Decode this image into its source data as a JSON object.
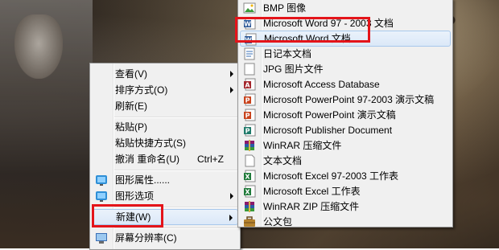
{
  "main_menu": {
    "items": [
      {
        "label": "查看(V)",
        "submenu": true
      },
      {
        "label": "排序方式(O)",
        "submenu": true
      },
      {
        "label": "刷新(E)"
      },
      {
        "label": "粘贴(P)"
      },
      {
        "label": "粘贴快捷方式(S)"
      },
      {
        "label": "撤消 重命名(U)",
        "shortcut": "Ctrl+Z"
      },
      {
        "label": "图形属性......",
        "icon": "graphics-properties-icon"
      },
      {
        "label": "图形选项",
        "icon": "graphics-options-icon",
        "submenu": true
      },
      {
        "label": "新建(W)",
        "submenu": true,
        "highlighted": true
      },
      {
        "label": "屏幕分辨率(C)",
        "icon": "screen-resolution-icon"
      }
    ]
  },
  "new_submenu": {
    "items": [
      {
        "label": "BMP 图像",
        "icon": "bmp-image-icon"
      },
      {
        "label": "Microsoft Word 97 - 2003 文档",
        "icon": "word-icon"
      },
      {
        "label": "Microsoft Word 文档",
        "icon": "word-icon",
        "highlighted": true
      },
      {
        "label": "日记本文档",
        "icon": "journal-icon"
      },
      {
        "label": "JPG 图片文件",
        "icon": "jpg-image-icon"
      },
      {
        "label": "Microsoft Access Database",
        "icon": "access-icon"
      },
      {
        "label": "Microsoft PowerPoint 97-2003 演示文稿",
        "icon": "powerpoint-icon"
      },
      {
        "label": "Microsoft PowerPoint 演示文稿",
        "icon": "powerpoint-icon"
      },
      {
        "label": "Microsoft Publisher Document",
        "icon": "publisher-icon"
      },
      {
        "label": "WinRAR 压缩文件",
        "icon": "winrar-icon"
      },
      {
        "label": "文本文档",
        "icon": "text-document-icon"
      },
      {
        "label": "Microsoft Excel 97-2003 工作表",
        "icon": "excel-icon"
      },
      {
        "label": "Microsoft Excel 工作表",
        "icon": "excel-icon"
      },
      {
        "label": "WinRAR ZIP 压缩文件",
        "icon": "winrar-zip-icon"
      },
      {
        "label": "公文包",
        "icon": "briefcase-icon"
      }
    ]
  },
  "colors": {
    "highlight_box": "#e4141a",
    "menu_bg": "#f0f0f0",
    "word_blue": "#2b5797",
    "excel_green": "#1f7a3a",
    "powerpoint_red": "#c8421b",
    "access_red": "#a4262c"
  }
}
